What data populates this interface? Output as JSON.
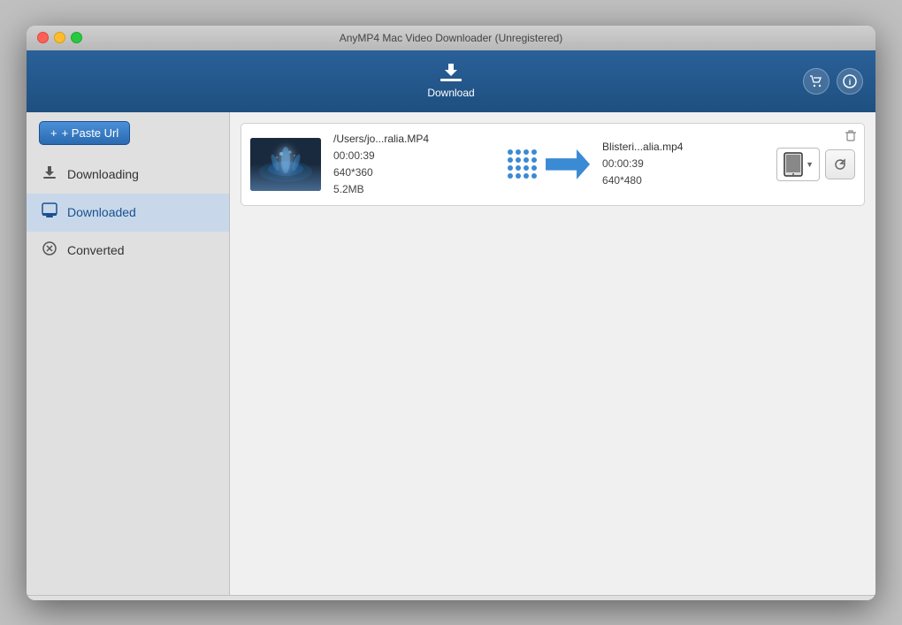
{
  "window": {
    "title": "AnyMP4 Mac Video Downloader (Unregistered)"
  },
  "toolbar": {
    "download_label": "Download",
    "shop_icon": "🛒",
    "info_icon": "ℹ"
  },
  "sidebar": {
    "paste_url_label": "+ Paste Url",
    "items": [
      {
        "id": "downloading",
        "label": "Downloading",
        "icon": "⬇"
      },
      {
        "id": "downloaded",
        "label": "Downloaded",
        "icon": "🎬"
      },
      {
        "id": "converted",
        "label": "Converted",
        "icon": "🔄"
      }
    ]
  },
  "content": {
    "active_tab": "downloaded",
    "items": [
      {
        "id": "item-1",
        "thumbnail_label": "",
        "source_filename": "/Users/jo...ralia.MP4",
        "source_duration": "00:00:39",
        "source_resolution": "640*360",
        "source_size": "5.2MB",
        "target_filename": "Blisteri...alia.mp4",
        "target_duration": "00:00:39",
        "target_resolution": "640*480"
      }
    ]
  },
  "buttons": {
    "delete": "🗑",
    "refresh": "↻"
  }
}
